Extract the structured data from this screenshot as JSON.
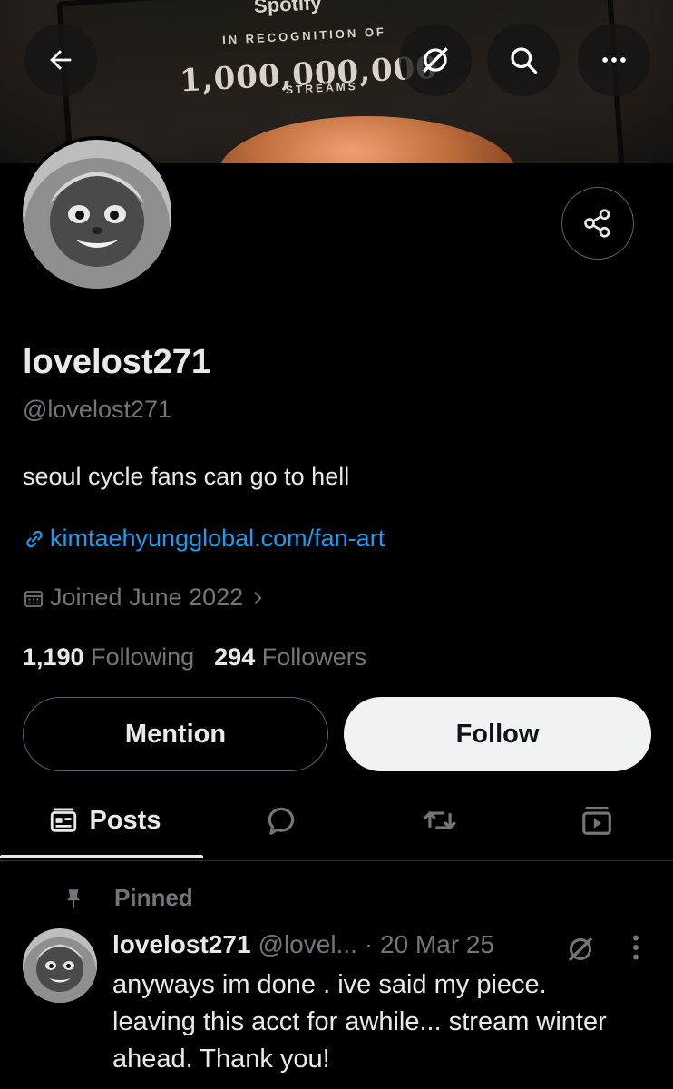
{
  "banner": {
    "brand": "Spotify",
    "recognition": "IN RECOGNITION OF",
    "count": "1,000,000,000",
    "unit": "STREAMS"
  },
  "header_icons": [
    "back-arrow-icon",
    "grok-icon",
    "search-icon",
    "more-icon"
  ],
  "profile": {
    "display_name": "lovelost271",
    "handle": "@lovelost271",
    "bio": "seoul cycle fans can go to hell",
    "link": "kimtaehyungglobal.com/fan-art",
    "joined": "Joined June 2022",
    "following_count": "1,190",
    "following_label": "Following",
    "followers_count": "294",
    "followers_label": "Followers"
  },
  "actions": {
    "mention_label": "Mention",
    "follow_label": "Follow"
  },
  "tabs": {
    "posts_label": "Posts",
    "icons": [
      "posts-icon",
      "replies-icon",
      "reposts-icon",
      "media-icon"
    ]
  },
  "pinned_post": {
    "pinned_label": "Pinned",
    "author": "lovelost271",
    "handle": "@lovel...",
    "date": "· 20 Mar 25",
    "text": "anyways im done . ive said my piece. leaving this acct for awhile... stream winter ahead. Thank you!"
  },
  "colors": {
    "background": "#000000",
    "text_primary": "#e7e9ea",
    "text_secondary": "#71767b",
    "link": "#1d9bf0",
    "follow_bg": "#eff3f4"
  }
}
